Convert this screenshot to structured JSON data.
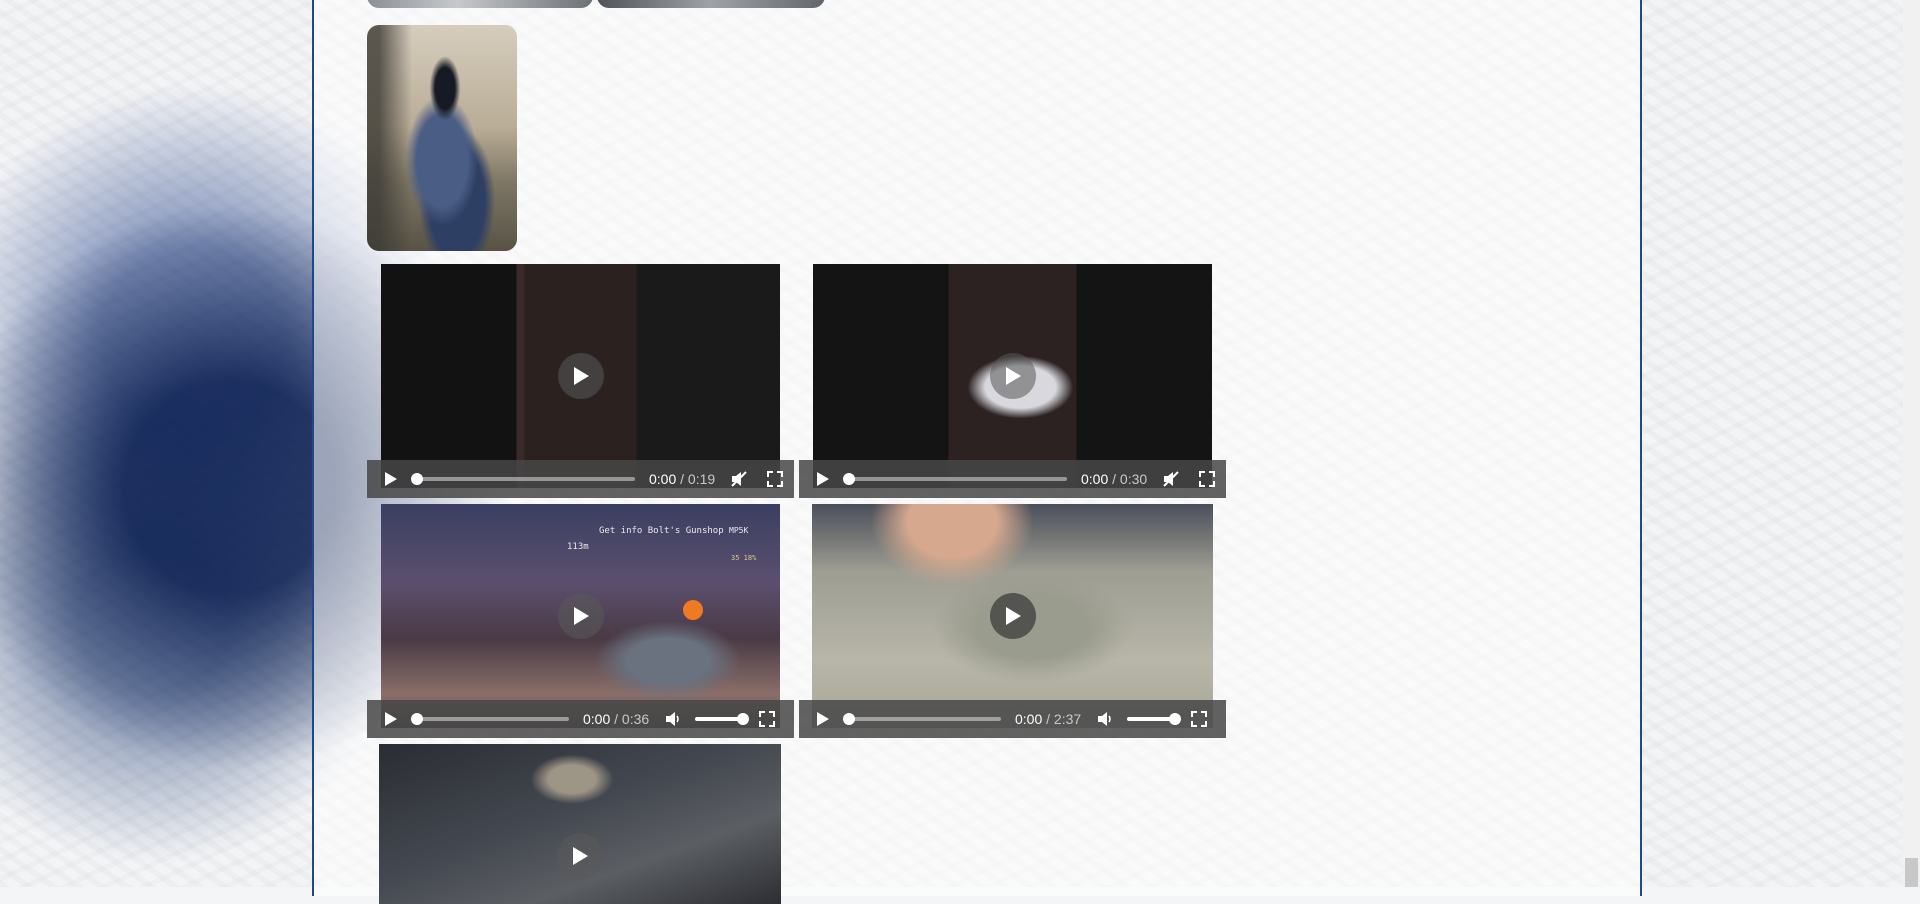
{
  "videos": [
    {
      "current_time": "0:00",
      "duration": "/ 0:19",
      "muted": true,
      "progress": 0
    },
    {
      "current_time": "0:00",
      "duration": "/ 0:30",
      "muted": true,
      "progress": 0
    },
    {
      "current_time": "0:00",
      "duration": "/ 0:36",
      "muted": false,
      "volume": 1.0,
      "progress": 0
    },
    {
      "current_time": "0:00",
      "duration": "/ 2:37",
      "muted": false,
      "volume": 1.0,
      "progress": 0
    }
  ],
  "game_hud": {
    "title": "Get info Bolt's Gunshop",
    "distance": "113m",
    "weapon": "MP5K",
    "ammo": "35 18%"
  },
  "colors": {
    "frame_border": "#1b4a84",
    "controls_bg": "#464646"
  }
}
